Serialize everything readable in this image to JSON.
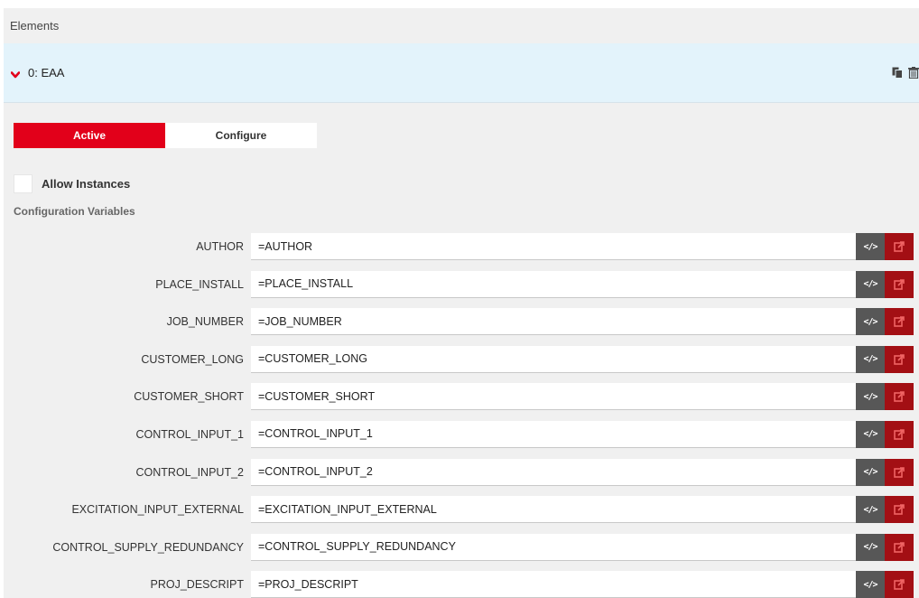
{
  "panel": {
    "header_title": "Elements"
  },
  "element": {
    "title": "0: EAA",
    "expand_icon": "chevron-down-icon",
    "accent_color": "#e2001a",
    "actions": [
      "copy-icon",
      "trash-icon"
    ]
  },
  "tabs": [
    {
      "label": "Active",
      "active": true
    },
    {
      "label": "Configure",
      "active": false
    }
  ],
  "allow_instances": {
    "label": "Allow Instances",
    "checked": false
  },
  "config_section_label": "Configuration Variables",
  "variables": [
    {
      "name": "AUTHOR",
      "value": "=AUTHOR"
    },
    {
      "name": "PLACE_INSTALL",
      "value": "=PLACE_INSTALL"
    },
    {
      "name": "JOB_NUMBER",
      "value": "=JOB_NUMBER"
    },
    {
      "name": "CUSTOMER_LONG",
      "value": "=CUSTOMER_LONG"
    },
    {
      "name": "CUSTOMER_SHORT",
      "value": "=CUSTOMER_SHORT"
    },
    {
      "name": "CONTROL_INPUT_1",
      "value": "=CONTROL_INPUT_1"
    },
    {
      "name": "CONTROL_INPUT_2",
      "value": "=CONTROL_INPUT_2"
    },
    {
      "name": "EXCITATION_INPUT_EXTERNAL",
      "value": "=EXCITATION_INPUT_EXTERNAL"
    },
    {
      "name": "CONTROL_SUPPLY_REDUNDANCY",
      "value": "=CONTROL_SUPPLY_REDUNDANCY"
    },
    {
      "name": "PROJ_DESCRIPT",
      "value": "=PROJ_DESCRIPT"
    }
  ],
  "variable_buttons": {
    "code_icon": "code-icon",
    "code_glyph": "</>",
    "link_icon": "external-link-icon",
    "code_color": "#575757",
    "link_color": "#a30f14"
  }
}
